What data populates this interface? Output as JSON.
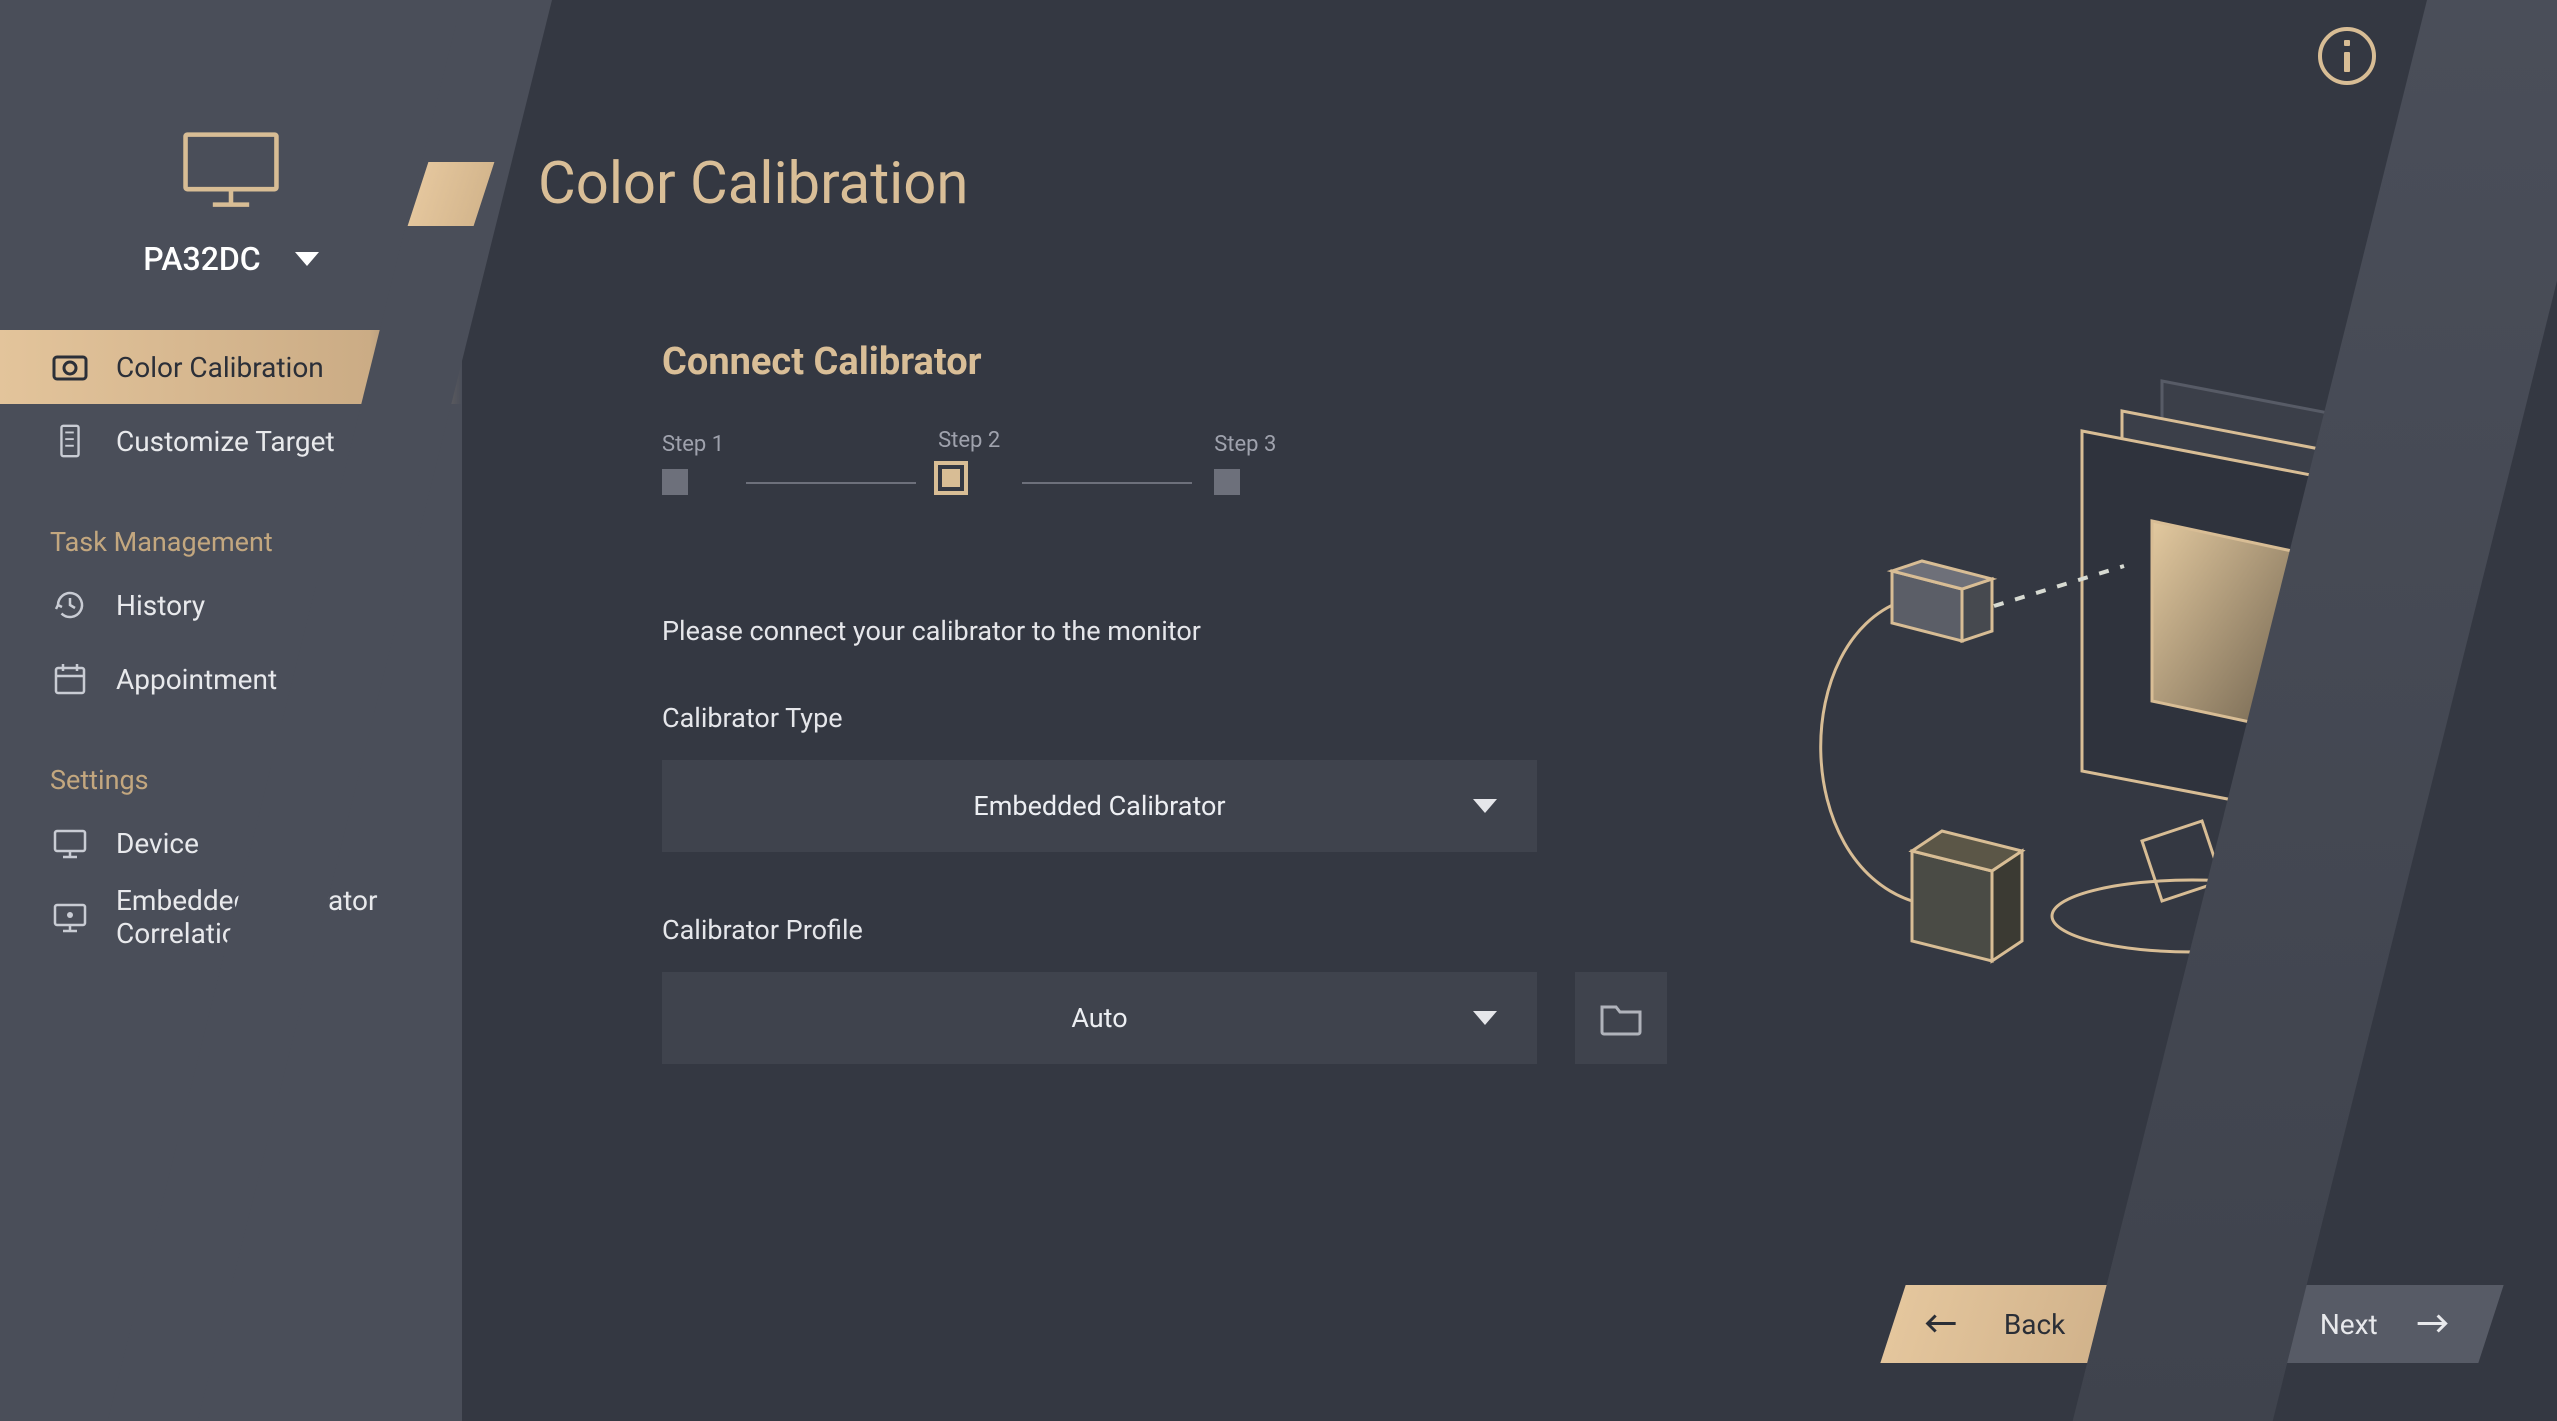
{
  "sidebar": {
    "device_selected": "PA32DC",
    "nav": {
      "color_calibration": "Color Calibration",
      "customize_target": "Customize Target"
    },
    "section_task": "Task Management",
    "task": {
      "history": "History",
      "appointment": "Appointment"
    },
    "section_settings": "Settings",
    "settings": {
      "device": "Device",
      "ecc": "Embedded Calibrator Correlation"
    }
  },
  "page": {
    "title": "Color Calibration",
    "section": "Connect Calibrator",
    "steps": {
      "s1": "Step 1",
      "s2": "Step 2",
      "s3": "Step 3",
      "active_index": 2
    },
    "instruction": "Please connect your calibrator to the monitor",
    "calibrator_type": {
      "label": "Calibrator Type",
      "selected": "Embedded Calibrator"
    },
    "calibrator_profile": {
      "label": "Calibrator Profile",
      "selected": "Auto"
    },
    "nav": {
      "back": "Back",
      "next": "Next"
    }
  },
  "colors": {
    "accent": "#d8bd95",
    "bg": "#343842",
    "panel": "#3f434d",
    "sidebar": "#4a4e59"
  }
}
